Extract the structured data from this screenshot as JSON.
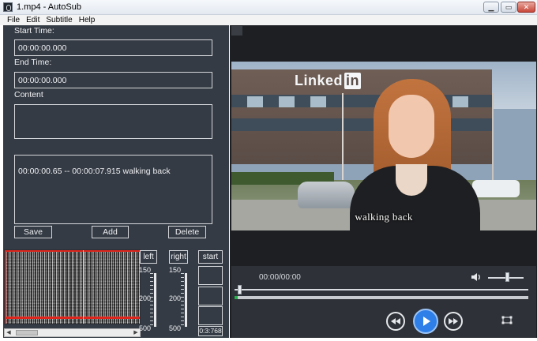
{
  "window": {
    "title": "1.mp4 - AutoSub",
    "minimize_glyph": "▁",
    "maximize_glyph": "▭",
    "close_glyph": "✕"
  },
  "menu": [
    "File",
    "Edit",
    "Subtitle",
    "Help"
  ],
  "editor": {
    "start_label": "Start Time:",
    "start_value": "00:00:00.000",
    "end_label": "End Time:",
    "end_value": "00:00:00.000",
    "content_label": "Content",
    "content_value": "",
    "subtitles": [
      {
        "start": "00:00:00.65",
        "end": "00:00:07.915",
        "text": "walking back",
        "display": "00:00:00.65 -- 00:00:07.915 walking back"
      }
    ],
    "save_label": "Save",
    "add_label": "Add",
    "delete_label": "Delete"
  },
  "waveform": {
    "left_label": "left",
    "right_label": "right",
    "start_label": "start",
    "scale_values": [
      "150",
      "200",
      "500"
    ],
    "time_value": "0:3:768",
    "selection_color": "#e0261c",
    "cursor_color": "#e3d31b"
  },
  "player": {
    "subtitle_text": "walking back",
    "video_logo": "Linked",
    "video_logo_in": "in",
    "time_readout": "00:00/00:00",
    "volume_level": 0.55,
    "seek_position": 0.01,
    "progress_fraction": 0.01,
    "progress_color": "#24b34a",
    "play_color": "#2f7fe8",
    "icons": [
      "volume-icon",
      "rewind-icon",
      "play-icon",
      "fast-forward-icon",
      "fullscreen-icon"
    ]
  }
}
